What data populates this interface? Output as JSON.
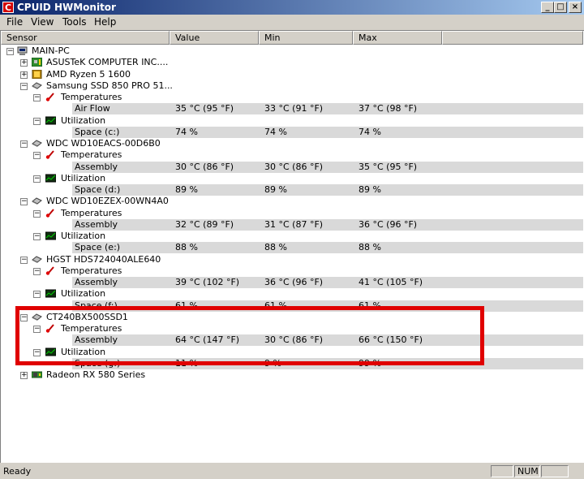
{
  "window": {
    "title": "CPUID HWMonitor",
    "app_icon_glyph": "C",
    "buttons": {
      "minimize": "_",
      "maximize": "□",
      "close": "×"
    }
  },
  "menu": [
    "File",
    "View",
    "Tools",
    "Help"
  ],
  "columns": {
    "sensor": "Sensor",
    "value": "Value",
    "min": "Min",
    "max": "Max"
  },
  "tree": {
    "root": "MAIN-PC",
    "devices": [
      {
        "name": "ASUSTeK COMPUTER INC....",
        "icon": "motherboard-icon"
      },
      {
        "name": "AMD Ryzen 5 1600",
        "icon": "cpu-icon"
      },
      {
        "name": "Samsung SSD 850 PRO 51...",
        "icon": "drive-icon",
        "temp_group": "Temperatures",
        "temp_label": "Air Flow",
        "temp_value": "35 °C  (95 °F)",
        "temp_min": "33 °C  (91 °F)",
        "temp_max": "37 °C  (98 °F)",
        "util_group": "Utilization",
        "util_label": "Space (c:)",
        "util_value": "74 %",
        "util_min": "74 %",
        "util_max": "74 %"
      },
      {
        "name": "WDC WD10EACS-00D6B0",
        "icon": "drive-icon",
        "temp_group": "Temperatures",
        "temp_label": "Assembly",
        "temp_value": "30 °C  (86 °F)",
        "temp_min": "30 °C  (86 °F)",
        "temp_max": "35 °C  (95 °F)",
        "util_group": "Utilization",
        "util_label": "Space (d:)",
        "util_value": "89 %",
        "util_min": "89 %",
        "util_max": "89 %"
      },
      {
        "name": "WDC WD10EZEX-00WN4A0",
        "icon": "drive-icon",
        "temp_group": "Temperatures",
        "temp_label": "Assembly",
        "temp_value": "32 °C  (89 °F)",
        "temp_min": "31 °C  (87 °F)",
        "temp_max": "36 °C  (96 °F)",
        "util_group": "Utilization",
        "util_label": "Space (e:)",
        "util_value": "88 %",
        "util_min": "88 %",
        "util_max": "88 %"
      },
      {
        "name": "HGST HDS724040ALE640",
        "icon": "drive-icon",
        "temp_group": "Temperatures",
        "temp_label": "Assembly",
        "temp_value": "39 °C  (102 °F)",
        "temp_min": "36 °C  (96 °F)",
        "temp_max": "41 °C  (105 °F)",
        "util_group": "Utilization",
        "util_label": "Space (f:)",
        "util_value": "61 %",
        "util_min": "61 %",
        "util_max": "61 %"
      },
      {
        "name": "CT240BX500SSD1",
        "icon": "drive-icon",
        "temp_group": "Temperatures",
        "temp_label": "Assembly",
        "temp_value": "64 °C  (147 °F)",
        "temp_min": "30 °C  (86 °F)",
        "temp_max": "66 °C  (150 °F)",
        "util_group": "Utilization",
        "util_label": "Space (g:)",
        "util_value": "11 %",
        "util_min": "9 %",
        "util_max": "99 %"
      },
      {
        "name": "Radeon RX 580 Series",
        "icon": "gpu-icon"
      }
    ]
  },
  "status": {
    "text": "Ready",
    "num": "NUM"
  },
  "colors": {
    "highlight_border": "#e00000",
    "title_gradient_start": "#0a246a"
  }
}
